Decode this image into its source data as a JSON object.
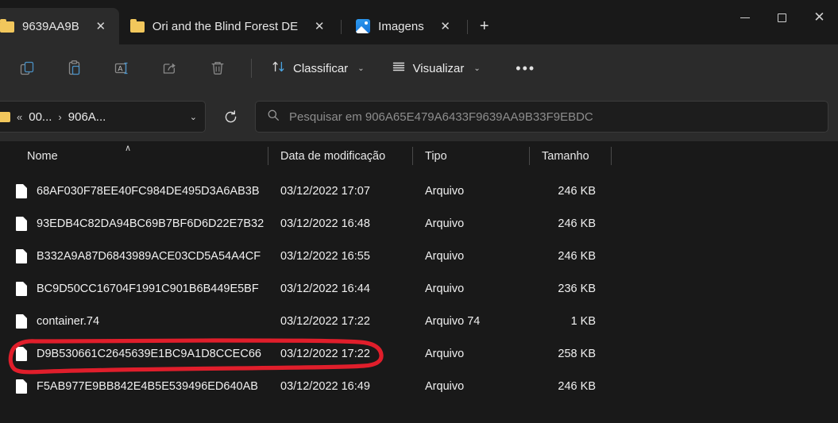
{
  "window": {
    "controls": {
      "minimize": "minimize-button",
      "maximize": "maximize-button",
      "close": "close-button"
    }
  },
  "tabs": [
    {
      "label": "9639AA9B",
      "icon": "folder-icon",
      "active": true,
      "close_label": "✕"
    },
    {
      "label": "Ori and the Blind Forest DE",
      "icon": "folder-icon",
      "active": false,
      "close_label": "✕"
    },
    {
      "label": "Imagens",
      "icon": "picture-icon",
      "active": false,
      "close_label": "✕"
    }
  ],
  "new_tab_label": "+",
  "toolbar": {
    "icons": [
      {
        "name": "copy-icon",
        "tip": "Copiar"
      },
      {
        "name": "paste-icon",
        "tip": "Colar"
      },
      {
        "name": "rename-icon",
        "tip": "Renomear"
      },
      {
        "name": "share-icon",
        "tip": "Compartilhar"
      },
      {
        "name": "delete-icon",
        "tip": "Excluir"
      }
    ],
    "sort_label": "Classificar",
    "view_label": "Visualizar",
    "more_label": "•••",
    "caret": "⌄"
  },
  "address": {
    "overflow": "«",
    "segments": [
      "00...",
      "906A..."
    ],
    "separator": "›",
    "dropdown_caret": "⌄",
    "refresh_label": "refresh-icon"
  },
  "search": {
    "placeholder": "Pesquisar em 906A65E479A6433F9639AA9B33F9EBDC",
    "icon": "search-icon"
  },
  "columns": {
    "name": "Nome",
    "date": "Data de modificação",
    "type": "Tipo",
    "size": "Tamanho",
    "sort_indicator": "∧"
  },
  "files": [
    {
      "name": "68AF030F78EE40FC984DE495D3A6AB3B",
      "date": "03/12/2022 17:07",
      "type": "Arquivo",
      "size": "246 KB",
      "highlighted": false
    },
    {
      "name": "93EDB4C82DA94BC69B7BF6D6D22E7B32",
      "date": "03/12/2022 16:48",
      "type": "Arquivo",
      "size": "246 KB",
      "highlighted": false
    },
    {
      "name": "B332A9A87D6843989ACE03CD5A54A4CF",
      "date": "03/12/2022 16:55",
      "type": "Arquivo",
      "size": "246 KB",
      "highlighted": false
    },
    {
      "name": "BC9D50CC16704F1991C901B6B449E5BF",
      "date": "03/12/2022 16:44",
      "type": "Arquivo",
      "size": "236 KB",
      "highlighted": false
    },
    {
      "name": "container.74",
      "date": "03/12/2022 17:22",
      "type": "Arquivo 74",
      "size": "1 KB",
      "highlighted": false
    },
    {
      "name": "D9B530661C2645639E1BC9A1D8CCEC66",
      "date": "03/12/2022 17:22",
      "type": "Arquivo",
      "size": "258 KB",
      "highlighted": true
    },
    {
      "name": "F5AB977E9BB842E4B5E539496ED640AB",
      "date": "03/12/2022 16:49",
      "type": "Arquivo",
      "size": "246 KB",
      "highlighted": false
    }
  ],
  "annotation": {
    "shape": "hand-drawn-rounded-rectangle",
    "color": "#e01e2b",
    "target_file": "D9B530661C2645639E1BC9A1D8CCEC66"
  },
  "colors": {
    "window_bg": "#191919",
    "chrome_bg": "#2b2b2b",
    "field_bg": "#1d1d1d",
    "text": "#f0f0f0",
    "muted_text": "#8d8d8d",
    "accent": "#4aa3e0",
    "folder": "#f2c75c"
  }
}
